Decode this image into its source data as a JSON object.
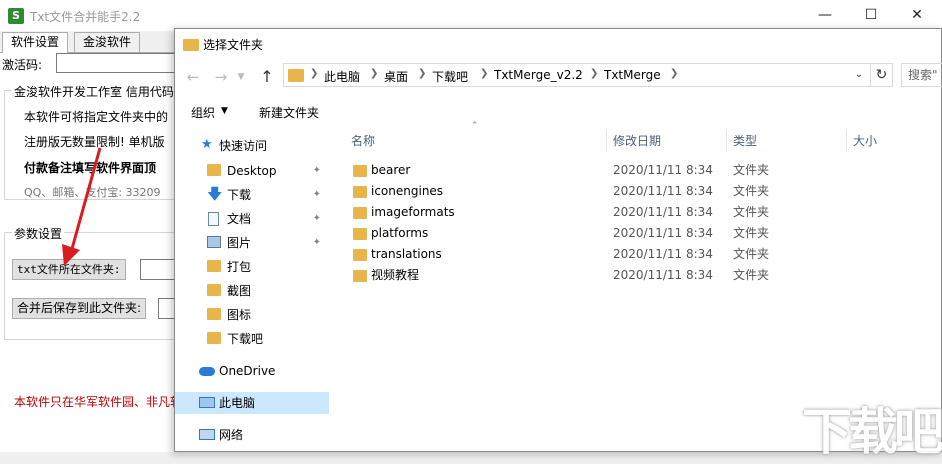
{
  "bg_window": {
    "title": "Txt文件合并能手2.2",
    "app_icon_glyph": "S",
    "tabs": [
      "软件设置",
      "金浚软件"
    ],
    "reg_label": "激活码:",
    "info_group_title": "金浚软件开发工作室  信用代码",
    "info_lines": [
      "本软件可将指定文件夹中的",
      "注册版无数量限制! 单机版",
      "付款备注填写软件界面顶",
      "QQ、邮箱、支付宝: 33209"
    ],
    "param_group_title": "参数设置",
    "txt_folder_button": "txt文件所在文件夹:",
    "save_folder_button": "合并后保存到此文件夹:",
    "footer_note": "本软件只在华军软件园、非凡软件站",
    "window_buttons": [
      "—",
      "☐",
      "✕"
    ]
  },
  "dialog": {
    "title": "选择文件夹",
    "breadcrumbs": [
      "此电脑",
      "桌面",
      "下载吧",
      "TxtMerge_v2.2",
      "TxtMerge"
    ],
    "search_placeholder": "搜索\"",
    "organize_label": "组织",
    "new_folder_label": "新建文件夹",
    "nav_pane": {
      "quick_access": "快速访问",
      "items": [
        "Desktop",
        "下载",
        "文档",
        "图片",
        "打包",
        "截图",
        "图标",
        "下载吧"
      ],
      "onedrive": "OneDrive",
      "this_pc": "此电脑",
      "network": "网络"
    },
    "columns": [
      "名称",
      "修改日期",
      "类型",
      "大小"
    ],
    "files": [
      {
        "name": "bearer",
        "date": "2020/11/11 8:34",
        "type": "文件夹"
      },
      {
        "name": "iconengines",
        "date": "2020/11/11 8:34",
        "type": "文件夹"
      },
      {
        "name": "imageformats",
        "date": "2020/11/11 8:34",
        "type": "文件夹"
      },
      {
        "name": "platforms",
        "date": "2020/11/11 8:34",
        "type": "文件夹"
      },
      {
        "name": "translations",
        "date": "2020/11/11 8:34",
        "type": "文件夹"
      },
      {
        "name": "视频教程",
        "date": "2020/11/11 8:34",
        "type": "文件夹"
      }
    ]
  },
  "watermark": "下载吧",
  "colors": {
    "folder": "#e8b54a",
    "selection": "#cce8ff",
    "arrow": "#d91d1d",
    "footer_red": "#c00000"
  }
}
